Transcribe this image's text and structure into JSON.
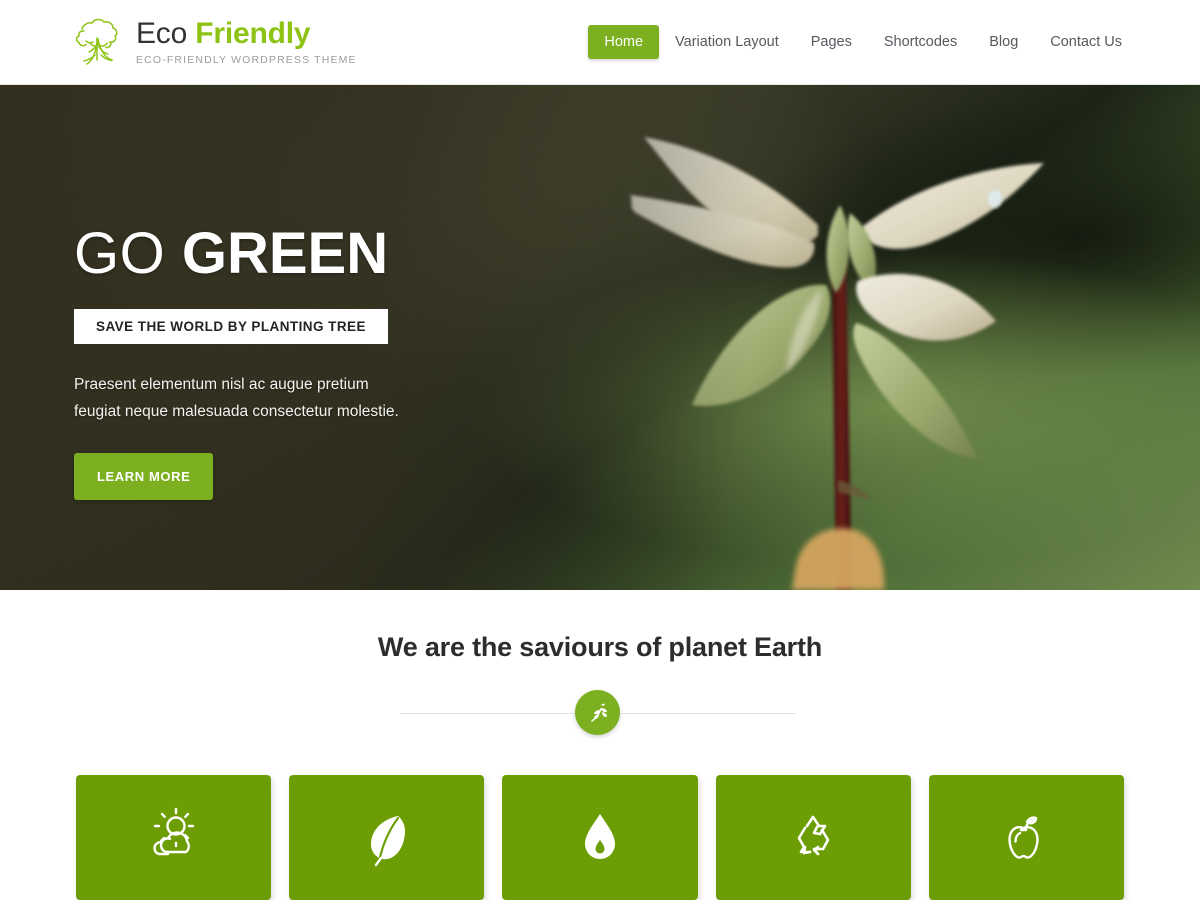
{
  "header": {
    "logo": {
      "icon": "tree-icon",
      "title_primary": "Eco",
      "title_accent": "Friendly",
      "tagline": "ECO-FRIENDLY WORDPRESS THEME"
    },
    "nav": [
      {
        "label": "Home",
        "active": true
      },
      {
        "label": "Variation Layout",
        "active": false
      },
      {
        "label": "Pages",
        "active": false
      },
      {
        "label": "Shortcodes",
        "active": false
      },
      {
        "label": "Blog",
        "active": false
      },
      {
        "label": "Contact Us",
        "active": false
      }
    ]
  },
  "hero": {
    "title_light": "GO",
    "title_bold": "GREEN",
    "banner": "SAVE THE WORLD BY PLANTING TREE",
    "description": "Praesent elementum nisl ac augue pretium feugiat neque malesuada consectetur molestie.",
    "button_label": "LEARN MORE",
    "image_alt": "seedling-photo"
  },
  "services": {
    "heading": "We are the saviours of planet Earth",
    "divider_icon": "leaf-branch-icon",
    "cards": [
      {
        "icon": "sun-cloud-icon"
      },
      {
        "icon": "leaf-icon"
      },
      {
        "icon": "water-drop-icon"
      },
      {
        "icon": "recycle-icon"
      },
      {
        "icon": "apple-icon"
      }
    ]
  },
  "colors": {
    "accent_green": "#7cb021",
    "card_green": "#6d9d04",
    "logo_green": "#8dc314",
    "text_dark": "#2d2d2d",
    "hero_overlay": "#302d1e"
  }
}
